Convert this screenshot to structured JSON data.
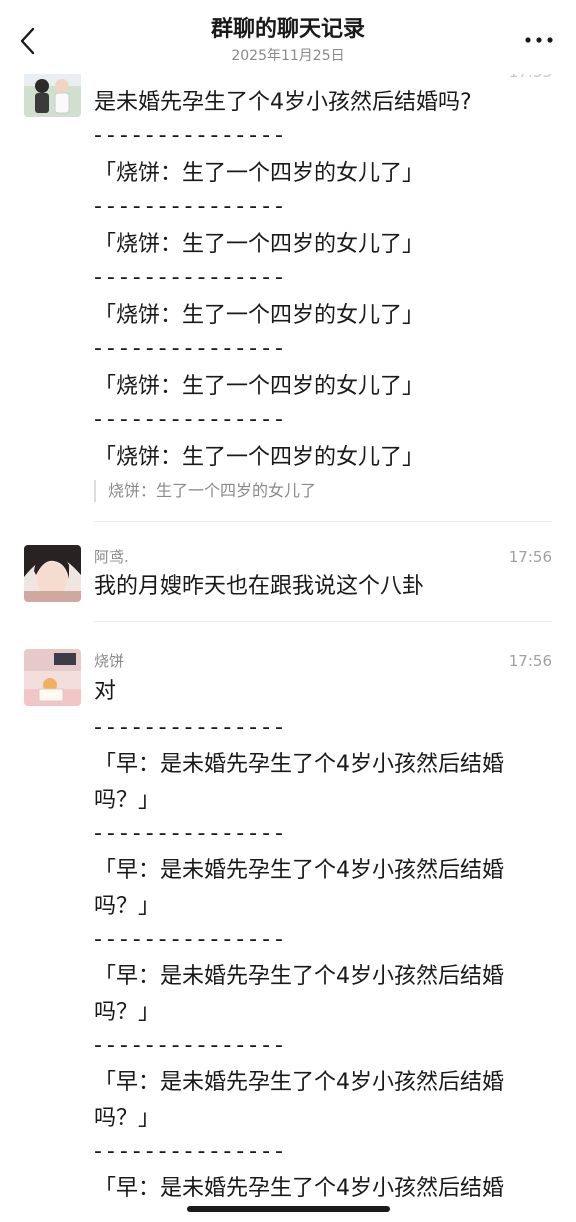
{
  "header": {
    "title": "群聊的聊天记录",
    "subtitle": "2025年11月25日"
  },
  "messages": [
    {
      "time": "17:55",
      "lines": [
        "是未婚先孕生了个4岁小孩然后结婚吗?",
        "- - - - - - - - - - - - - - -",
        "「烧饼：生了一个四岁的女儿了」",
        "- - - - - - - - - - - - - - -",
        "「烧饼：生了一个四岁的女儿了」",
        "- - - - - - - - - - - - - - -",
        "「烧饼：生了一个四岁的女儿了」",
        "- - - - - - - - - - - - - - -",
        "「烧饼：生了一个四岁的女儿了」",
        "- - - - - - - - - - - - - - -",
        "「烧饼：生了一个四岁的女儿了」"
      ],
      "quote": "烧饼：生了一个四岁的女儿了"
    },
    {
      "sender": "阿鸢.",
      "time": "17:56",
      "lines": [
        "我的月嫂昨天也在跟我说这个八卦"
      ]
    },
    {
      "sender": "烧饼",
      "time": "17:56",
      "lines": [
        "对",
        "- - - - - - - - - - - - - - -",
        "「早：是未婚先孕生了个4岁小孩然后结婚",
        "吗？」",
        "- - - - - - - - - - - - - - -",
        "「早：是未婚先孕生了个4岁小孩然后结婚",
        "吗？」",
        "- - - - - - - - - - - - - - -",
        "「早：是未婚先孕生了个4岁小孩然后结婚",
        "吗？」",
        "- - - - - - - - - - - - - - -",
        "「早：是未婚先孕生了个4岁小孩然后结婚",
        "吗？」",
        "- - - - - - - - - - - - - - -",
        "「早：是未婚先孕生了个4岁小孩然后结婚"
      ]
    }
  ],
  "icons": {
    "back": "chevron-left-icon",
    "more": "more-dots-icon"
  }
}
